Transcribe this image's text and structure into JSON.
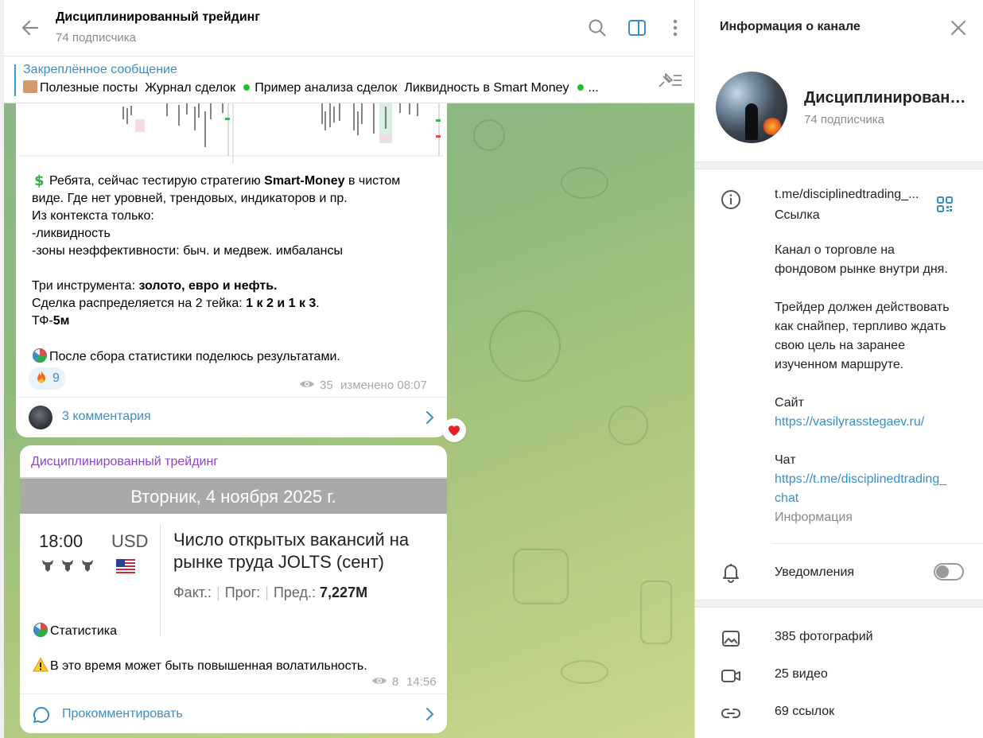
{
  "chat": {
    "title": "Дисциплинированный трейдинг",
    "subscribers": "74 подписчика"
  },
  "pinned": {
    "title": "Закреплённое сообщение",
    "items": [
      "Полезные посты",
      "Журнал сделок",
      "Пример анализа сделок",
      "Ликвидность в Smart Money",
      "..."
    ]
  },
  "post1": {
    "lines": [
      {
        "parts": [
          "Ребята, сейчас тестирую стратегию ",
          "Smart-Money",
          " в чистом"
        ]
      },
      {
        "parts": [
          "виде. Где нет уровней, трендовых, индикаторов и пр."
        ]
      },
      {
        "parts": [
          "Из контекста только:"
        ]
      },
      {
        "parts": [
          "-ликвидность"
        ]
      },
      {
        "parts": [
          "-зоны неэффективности: быч. и медвеж. имбалансы"
        ]
      },
      {
        "parts": [
          ""
        ]
      },
      {
        "parts": [
          "Три инструмента: ",
          "золото, евро и нефть."
        ]
      },
      {
        "parts": [
          "Сделка распределяется на 2 тейка: ",
          "1 к 2 и 1 к 3",
          "."
        ]
      },
      {
        "parts": [
          "ТФ-",
          "5м"
        ]
      },
      {
        "parts": [
          ""
        ]
      },
      {
        "parts": [
          "После сбора статистики поделюсь результатами."
        ]
      }
    ],
    "reaction_count": "9",
    "views": "35",
    "edited": "изменено 08:07",
    "comments": "3 комментария"
  },
  "post2": {
    "author": "Дисциплинированный трейдинг",
    "calendar": {
      "date": "Вторник, 4 ноября 2025 г.",
      "time": "18:00",
      "currency": "USD",
      "event": "Число открытых вакансий на рынке труда JOLTS (сент)",
      "fact_label": "Факт.:",
      "forecast_label": "Прог:",
      "previous_label": "Пред.:",
      "previous_value": "7,227M"
    },
    "line1": "Статистика",
    "line2": "В это время может быть повышенная волатильность.",
    "views": "8",
    "time": "14:56",
    "comment_label": "Прокомментировать"
  },
  "info": {
    "title": "Информация о канале",
    "name": "Дисциплинированный трейдинг",
    "subscribers": "74 подписчика",
    "link": "t.me/disciplinedtrading_...",
    "link_label": "Ссылка",
    "description_lines": [
      "Канал о торговле на",
      "фондовом рынке внутри дня.",
      "",
      "Трейдер должен действовать",
      "как снайпер, терпливо ждать",
      "свою цель на заранее",
      "изученном маршруте.",
      "",
      "Сайт"
    ],
    "site_url": "https://vasilyrasstegaev.ru/",
    "chat_label": "Чат",
    "chat_url_1": "https://t.me/disciplinedtrading_",
    "chat_url_2": "chat",
    "info_label": "Информация",
    "notifications": "Уведомления",
    "photos": "385 фотографий",
    "videos": "25 видео",
    "links": "69 ссылок"
  },
  "colors": {
    "accent": "#3a8ec8",
    "author": "#8e44c8",
    "online_dot": "#22c02a"
  }
}
